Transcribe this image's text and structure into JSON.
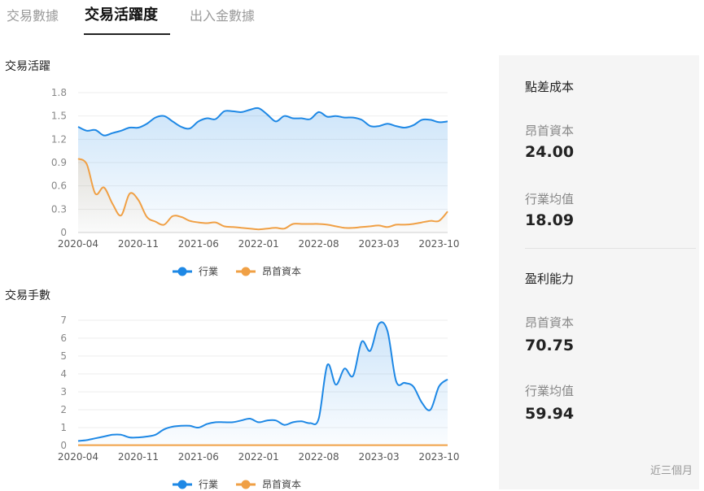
{
  "tabs": [
    {
      "label": "交易數據",
      "active": false
    },
    {
      "label": "交易活躍度",
      "active": true
    },
    {
      "label": "出入金數據",
      "active": false
    }
  ],
  "colors": {
    "industry": "#1e88e5",
    "company": "#f0a045",
    "industry_fill": "#ddeefb"
  },
  "chart_data": [
    {
      "type": "area",
      "title": "交易活躍",
      "x_ticks": [
        "2020-04",
        "2020-11",
        "2021-06",
        "2022-01",
        "2022-08",
        "2023-03",
        "2023-10"
      ],
      "x_range": [
        "2020-04",
        "2023-11"
      ],
      "ylim": [
        0,
        1.8
      ],
      "y_ticks": [
        "0",
        "0.3",
        "0.6",
        "0.9",
        "1.2",
        "1.5",
        "1.8"
      ],
      "legend": [
        "行業",
        "昂首資本"
      ],
      "legend_position": "bottom",
      "series": [
        {
          "name": "行業",
          "color": "#1e88e5",
          "fill": true,
          "x": [
            "2020-04",
            "2020-05",
            "2020-06",
            "2020-07",
            "2020-08",
            "2020-09",
            "2020-10",
            "2020-11",
            "2020-12",
            "2021-01",
            "2021-02",
            "2021-03",
            "2021-04",
            "2021-05",
            "2021-06",
            "2021-07",
            "2021-08",
            "2021-09",
            "2021-10",
            "2021-11",
            "2021-12",
            "2022-01",
            "2022-02",
            "2022-03",
            "2022-04",
            "2022-05",
            "2022-06",
            "2022-07",
            "2022-08",
            "2022-09",
            "2022-10",
            "2022-11",
            "2022-12",
            "2023-01",
            "2023-02",
            "2023-03",
            "2023-04",
            "2023-05",
            "2023-06",
            "2023-07",
            "2023-08",
            "2023-09",
            "2023-10",
            "2023-11"
          ],
          "values": [
            1.36,
            1.31,
            1.32,
            1.25,
            1.28,
            1.31,
            1.35,
            1.35,
            1.4,
            1.48,
            1.5,
            1.43,
            1.36,
            1.34,
            1.43,
            1.47,
            1.46,
            1.56,
            1.56,
            1.55,
            1.58,
            1.6,
            1.52,
            1.43,
            1.5,
            1.47,
            1.47,
            1.46,
            1.55,
            1.49,
            1.5,
            1.48,
            1.48,
            1.45,
            1.37,
            1.37,
            1.4,
            1.37,
            1.35,
            1.38,
            1.45,
            1.45,
            1.42,
            1.43
          ]
        },
        {
          "name": "昂首資本",
          "color": "#f0a045",
          "fill": true,
          "x": [
            "2020-04",
            "2020-05",
            "2020-06",
            "2020-07",
            "2020-08",
            "2020-09",
            "2020-10",
            "2020-11",
            "2020-12",
            "2021-01",
            "2021-02",
            "2021-03",
            "2021-04",
            "2021-05",
            "2021-06",
            "2021-07",
            "2021-08",
            "2021-09",
            "2021-10",
            "2021-11",
            "2021-12",
            "2022-01",
            "2022-02",
            "2022-03",
            "2022-04",
            "2022-05",
            "2022-06",
            "2022-07",
            "2022-08",
            "2022-09",
            "2022-10",
            "2022-11",
            "2022-12",
            "2023-01",
            "2023-02",
            "2023-03",
            "2023-04",
            "2023-05",
            "2023-06",
            "2023-07",
            "2023-08",
            "2023-09",
            "2023-10",
            "2023-11"
          ],
          "values": [
            0.95,
            0.88,
            0.5,
            0.58,
            0.37,
            0.22,
            0.5,
            0.42,
            0.2,
            0.14,
            0.1,
            0.21,
            0.2,
            0.15,
            0.13,
            0.12,
            0.13,
            0.08,
            0.07,
            0.06,
            0.05,
            0.04,
            0.05,
            0.06,
            0.05,
            0.11,
            0.11,
            0.11,
            0.11,
            0.1,
            0.08,
            0.06,
            0.06,
            0.07,
            0.08,
            0.09,
            0.07,
            0.1,
            0.1,
            0.11,
            0.13,
            0.15,
            0.15,
            0.27
          ]
        }
      ]
    },
    {
      "type": "area",
      "title": "交易手數",
      "x_ticks": [
        "2020-04",
        "2020-11",
        "2021-06",
        "2022-01",
        "2022-08",
        "2023-03",
        "2023-10"
      ],
      "x_range": [
        "2020-04",
        "2023-11"
      ],
      "ylim": [
        0,
        7
      ],
      "y_ticks": [
        "0",
        "1",
        "2",
        "3",
        "4",
        "5",
        "6",
        "7"
      ],
      "legend": [
        "行業",
        "昂首資本"
      ],
      "legend_position": "bottom",
      "series": [
        {
          "name": "行業",
          "color": "#1e88e5",
          "fill": true,
          "x": [
            "2020-04",
            "2020-05",
            "2020-06",
            "2020-07",
            "2020-08",
            "2020-09",
            "2020-10",
            "2020-11",
            "2020-12",
            "2021-01",
            "2021-02",
            "2021-03",
            "2021-04",
            "2021-05",
            "2021-06",
            "2021-07",
            "2021-08",
            "2021-09",
            "2021-10",
            "2021-11",
            "2021-12",
            "2022-01",
            "2022-02",
            "2022-03",
            "2022-04",
            "2022-05",
            "2022-06",
            "2022-07",
            "2022-08",
            "2022-09",
            "2022-10",
            "2022-11",
            "2022-12",
            "2023-01",
            "2023-02",
            "2023-03",
            "2023-04",
            "2023-05",
            "2023-06",
            "2023-07",
            "2023-08",
            "2023-09",
            "2023-10",
            "2023-11"
          ],
          "values": [
            0.25,
            0.3,
            0.4,
            0.5,
            0.6,
            0.6,
            0.45,
            0.45,
            0.5,
            0.6,
            0.9,
            1.05,
            1.1,
            1.1,
            1.0,
            1.2,
            1.3,
            1.3,
            1.3,
            1.4,
            1.5,
            1.3,
            1.4,
            1.4,
            1.15,
            1.3,
            1.35,
            1.25,
            1.5,
            4.5,
            3.4,
            4.3,
            3.9,
            5.8,
            5.3,
            6.8,
            6.4,
            3.6,
            3.5,
            3.3,
            2.4,
            2.0,
            3.3,
            3.7
          ]
        },
        {
          "name": "昂首資本",
          "color": "#f0a045",
          "fill": false,
          "x": [
            "2020-04",
            "2023-11"
          ],
          "values": [
            0.02,
            0.02
          ]
        }
      ]
    }
  ],
  "panel": {
    "spread_title": "點差成本",
    "spread_company_label": "昂首資本",
    "spread_company_value": "24.00",
    "spread_industry_label": "行業均值",
    "spread_industry_value": "18.09",
    "profit_title": "盈利能力",
    "profit_company_label": "昂首資本",
    "profit_company_value": "70.75",
    "profit_industry_label": "行業均值",
    "profit_industry_value": "59.94",
    "footnote": "近三個月"
  }
}
